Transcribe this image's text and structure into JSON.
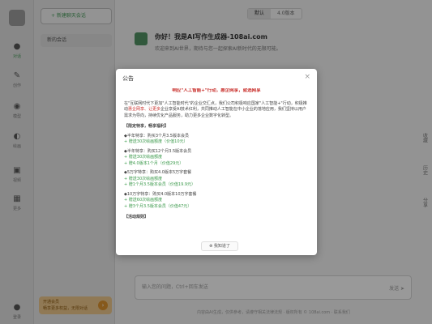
{
  "rail": {
    "items": [
      {
        "label": "对话",
        "icon": "chat-icon"
      },
      {
        "label": "创作",
        "icon": "feather-icon"
      },
      {
        "label": "模型",
        "icon": "model-icon"
      },
      {
        "label": "绘画",
        "icon": "palette-icon"
      },
      {
        "label": "视频",
        "icon": "video-icon"
      },
      {
        "label": "更多",
        "icon": "grid-icon"
      }
    ],
    "bottom": {
      "label": "登录",
      "icon": "user-icon"
    }
  },
  "sidebar": {
    "new_chat": "+ 新建聊天会话",
    "conversation": "新的会话",
    "promo_title": "开通会员",
    "promo_sub": "畅享更多权益，无限对话",
    "promo_badge": "›"
  },
  "main": {
    "versions": [
      "默认",
      "4.0版本"
    ],
    "welcome_title": "你好！我是AI写作生成器-108ai.com",
    "welcome_sub": "欢迎来到AI世界，期待与您一起探索AI新时代的无限可能。",
    "rightbar": [
      "收藏",
      "历史",
      "分享"
    ],
    "input_placeholder": "输入您的问题，Ctrl+回车发送",
    "send_label": "发送 ➤",
    "footer": "内容由AI生成，仅供参考，请遵守相关法律法规 · 版权所有 © 108ai.com · 联系我们"
  },
  "modal": {
    "title": "公告",
    "close": "×",
    "headline": "响应\"人工智能+\"行动，惠企网享，就选网享",
    "intro_1": "在\"互联网时代下更加\"人工智能时代\"的企业交汇点，我们公司积极响应国家\"人工智能+\"行动，积极推动",
    "intro_red": "惠企网享、让更多",
    "intro_2": "企业享受AI技术红利，共同推动人工智能在中小企业的落地应用，我们坚持以用户需求为导向，持续优化产品服务，助力更多企业数字化转型。",
    "section_title": "【限定特享，畅享福利】",
    "offers": [
      {
        "title": "◆半年特享：购买3个月3.5版本会员",
        "lines": [
          "+ 赠送30次绘画额度（价值10元）"
        ]
      },
      {
        "title": "◆半年特享：购买12个月3.5版本会员",
        "lines": [
          "+ 赠送30次绘画额度",
          "+ 赠4.0版本1个月（价值29元）"
        ]
      },
      {
        "title": "◆5万字特享：购买4.0版本5万字套餐",
        "lines": [
          "+ 赠送30次绘画额度",
          "+ 赠1个月3.5版本会员（价值19.9元）"
        ]
      },
      {
        "title": "◆10万字特享：购买4.0版本10万字套餐",
        "lines": [
          "+ 赠送60次绘画额度",
          "+ 赠3个月3.5版本会员（价值47元）"
        ]
      }
    ],
    "footer_section": "【活动规则】",
    "ok_label": "⊗ 我知道了"
  }
}
